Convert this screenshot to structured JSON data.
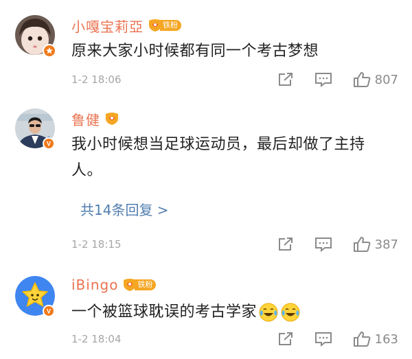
{
  "comments": [
    {
      "username": "小嘎宝莉亞",
      "fan_badge": "铁粉",
      "text": "原来大家小时候都有同一个考古梦想",
      "time": "1-2 18:06",
      "likes": "807"
    },
    {
      "username": "鲁健",
      "text": "我小时候想当足球运动员，最后却做了主持人。",
      "replies_link": "共14条回复 >",
      "time": "1-2 18:15",
      "likes": "387"
    },
    {
      "username": "iBingo",
      "fan_badge": "铁粉",
      "text": "一个被篮球耽误的考古学家",
      "time": "1-2 18:04",
      "likes": "163"
    }
  ],
  "colors": {
    "username": "#eb7350",
    "link": "#507daf",
    "meta": "#a6a6a6",
    "verified_orange": "#f07a1a",
    "verified_red": "#e8532f",
    "fan_badge": "#f5a623"
  },
  "icons": [
    "share-icon",
    "comment-icon",
    "like-icon",
    "laugh-cry-emoji",
    "fan-badge-icon",
    "verified-badge-icon"
  ]
}
